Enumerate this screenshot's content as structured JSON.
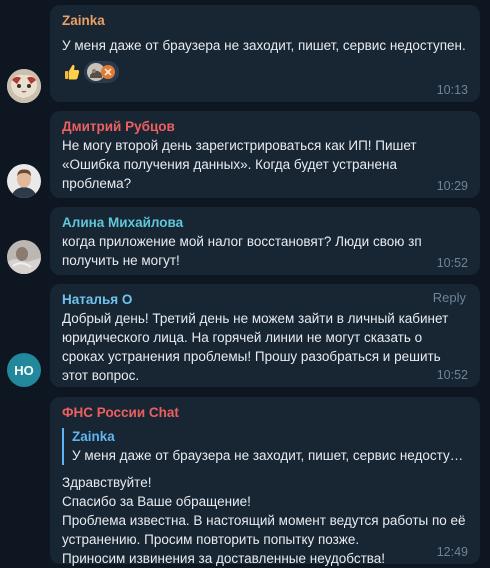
{
  "colors": {
    "background": "#0e1621",
    "bubble": "#182533",
    "author_zainka": "#e8a064",
    "author_red": "#ee5f60",
    "author_teal": "#5fc7d9",
    "author_blue": "#6ec4f0",
    "quote_accent": "#5fb5ef",
    "avatar_no": "#22899d"
  },
  "messages": [
    {
      "author": "Zainka",
      "text": "У меня даже от браузера не заходит, пишет, сервис недоступен.",
      "time": "10:13",
      "reactions": [
        "thumbs-up-emoji",
        "reactor-avatar"
      ]
    },
    {
      "author": "Дмитрий Рубцов",
      "text": "Не могу второй день зарегистрироваться как ИП! Пишет «Ошибка получения данных». Когда будет устранена проблема?",
      "time": "10:29"
    },
    {
      "author": "Алина Михайлова",
      "text": "когда приложение мой налог восстановят? Люди свою зп получить не могут!",
      "time": "10:52"
    },
    {
      "author": "Наталья О",
      "reply_label": "Reply",
      "text": "Добрый день! Третий день не можем зайти в личный кабинет юридического лица. На горячей линии не могут сказать о сроках устранения проблемы! Прошу разобраться и решить этот вопрос.",
      "time": "10:52",
      "avatar_initials": "НО"
    },
    {
      "author": "ФНС России Chat",
      "quote_author": "Zainka",
      "quote_text": "У меня даже от браузера не заходит, пишет, сервис недосту…",
      "lines": [
        "Здравствуйте!",
        "Спасибо за Ваше обращение!",
        "Проблема известна. В настоящий момент ведутся работы по её устранению. Просим повторить попытку позже.",
        "Приносим извинения за доставленные неудобства!"
      ],
      "time": "12:49"
    }
  ]
}
